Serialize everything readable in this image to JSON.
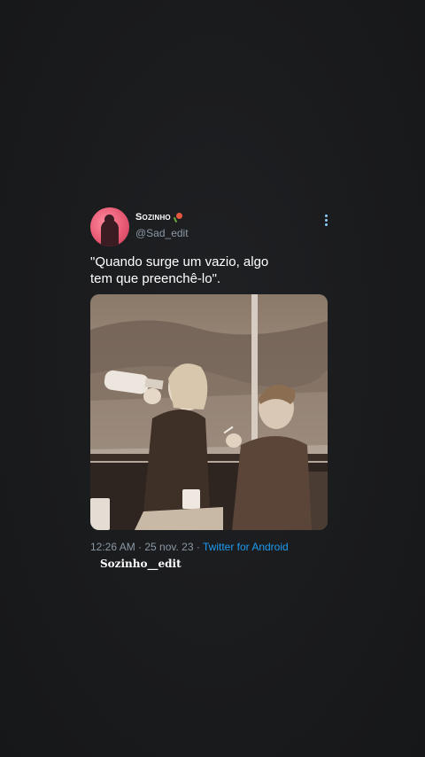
{
  "tweet": {
    "display_name": "Sozinho",
    "name_icon": "rose-icon",
    "handle": "@Sad_edit",
    "text": "\"Quando surge um vazio, algo\ntem que preenchê-lo\".",
    "time": "12:26 AM",
    "separator": " · ",
    "date": "25 nov. 23",
    "source": "Twitter for Android"
  },
  "watermark": "Sozinho__edit",
  "colors": {
    "background": "#1a1b1d",
    "text": "#ffffff",
    "muted": "#8b98a5",
    "link": "#1d9bf0",
    "avatar": "#e85a74"
  }
}
